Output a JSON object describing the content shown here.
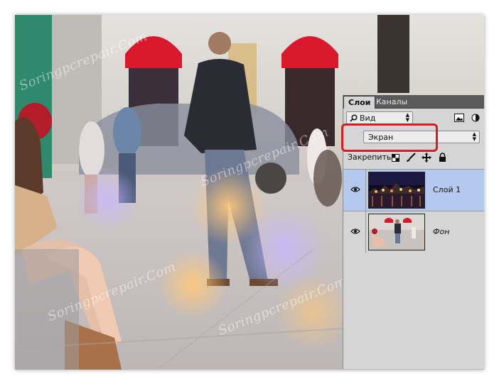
{
  "panel": {
    "tabs": [
      {
        "label": "Слои",
        "active": true
      },
      {
        "label": "Каналы",
        "active": false
      }
    ],
    "filter_label": "Вид",
    "blend_mode": "Экран",
    "lock_label": "Закрепить:",
    "layers": [
      {
        "name": "Слой 1",
        "visible": true,
        "selected": true
      },
      {
        "name": "Фон",
        "visible": true,
        "selected": false
      }
    ]
  },
  "watermark": "Soringpcrepair.Com",
  "colors": {
    "highlight": "#d81d1d",
    "selected_layer": "#b5c9ee",
    "panel_bg": "#d5d5d5",
    "tab_bar": "#5a5a5a"
  }
}
